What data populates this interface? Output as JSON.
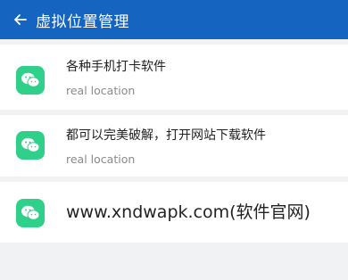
{
  "header": {
    "title": "虚拟位置管理",
    "background": "#1565c0",
    "back_icon": "arrow-left-icon"
  },
  "items": [
    {
      "title": "各种手机打卡软件",
      "subtitle": "real location",
      "icon": "wechat-icon"
    },
    {
      "title": "都可以完美破解，打开网站下载软件",
      "subtitle": "real location",
      "icon": "wechat-icon"
    },
    {
      "title": "www.xndwapk.com(软件官网)",
      "icon": "wechat-icon"
    }
  ],
  "colors": {
    "icon_bg": "#2fd18a",
    "page_bg": "#f1f2f4"
  }
}
